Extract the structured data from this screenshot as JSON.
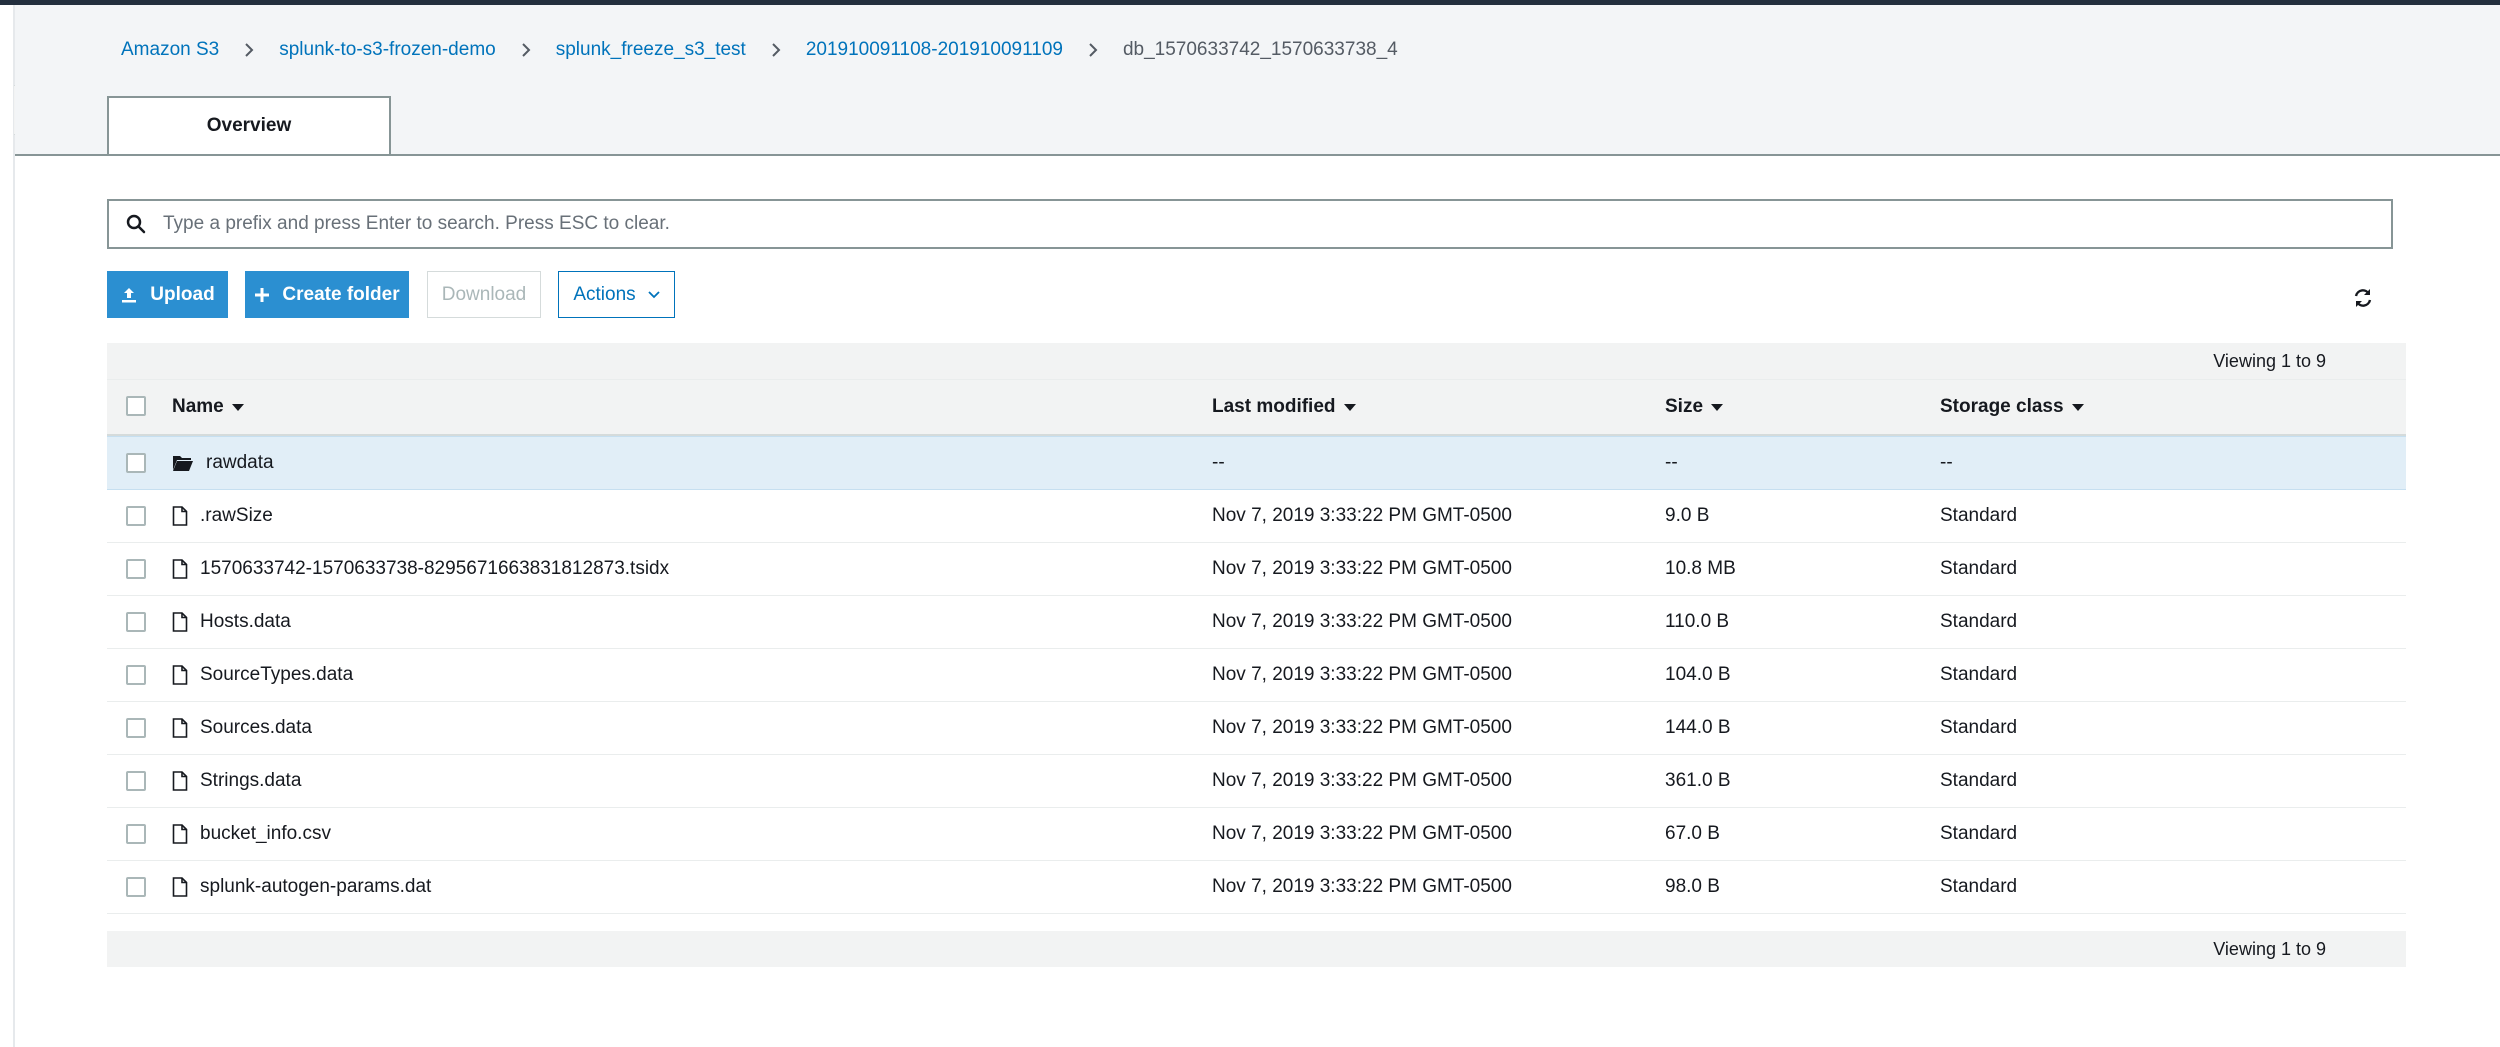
{
  "breadcrumb": [
    {
      "label": "Amazon S3",
      "link": true
    },
    {
      "label": "splunk-to-s3-frozen-demo",
      "link": true
    },
    {
      "label": "splunk_freeze_s3_test",
      "link": true
    },
    {
      "label": "201910091108-201910091109",
      "link": true
    },
    {
      "label": "db_1570633742_1570633738_4",
      "link": false
    }
  ],
  "tabs": {
    "overview": "Overview"
  },
  "search": {
    "placeholder": "Type a prefix and press Enter to search. Press ESC to clear."
  },
  "toolbar": {
    "upload": "Upload",
    "create_folder": "Create folder",
    "download": "Download",
    "actions": "Actions"
  },
  "table": {
    "viewing_top": "Viewing 1 to 9",
    "viewing_bottom": "Viewing 1 to 9",
    "columns": {
      "name": "Name",
      "last_modified": "Last modified",
      "size": "Size",
      "storage_class": "Storage class"
    },
    "rows": [
      {
        "type": "folder",
        "name": "rawdata",
        "modified": "--",
        "size": "--",
        "class": "--"
      },
      {
        "type": "file",
        "name": ".rawSize",
        "modified": "Nov 7, 2019 3:33:22 PM GMT-0500",
        "size": "9.0 B",
        "class": "Standard"
      },
      {
        "type": "file",
        "name": "1570633742-1570633738-8295671663831812873.tsidx",
        "modified": "Nov 7, 2019 3:33:22 PM GMT-0500",
        "size": "10.8 MB",
        "class": "Standard"
      },
      {
        "type": "file",
        "name": "Hosts.data",
        "modified": "Nov 7, 2019 3:33:22 PM GMT-0500",
        "size": "110.0 B",
        "class": "Standard"
      },
      {
        "type": "file",
        "name": "SourceTypes.data",
        "modified": "Nov 7, 2019 3:33:22 PM GMT-0500",
        "size": "104.0 B",
        "class": "Standard"
      },
      {
        "type": "file",
        "name": "Sources.data",
        "modified": "Nov 7, 2019 3:33:22 PM GMT-0500",
        "size": "144.0 B",
        "class": "Standard"
      },
      {
        "type": "file",
        "name": "Strings.data",
        "modified": "Nov 7, 2019 3:33:22 PM GMT-0500",
        "size": "361.0 B",
        "class": "Standard"
      },
      {
        "type": "file",
        "name": "bucket_info.csv",
        "modified": "Nov 7, 2019 3:33:22 PM GMT-0500",
        "size": "67.0 B",
        "class": "Standard"
      },
      {
        "type": "file",
        "name": "splunk-autogen-params.dat",
        "modified": "Nov 7, 2019 3:33:22 PM GMT-0500",
        "size": "98.0 B",
        "class": "Standard"
      }
    ]
  },
  "icons": {
    "search": "search-icon",
    "upload": "upload-icon",
    "create_folder": "plus-icon",
    "actions": "chevron-down-icon",
    "refresh": "refresh-icon",
    "folder": "folder-open-icon",
    "file": "file-icon",
    "breadcrumb_separator": "chevron-right-icon",
    "sidebar_toggle": "caret-right-icon"
  },
  "colors": {
    "link": "#0073bb",
    "primary_button": "#2b8fd1",
    "selected_row": "#e1eef7",
    "header_band": "#f3f5f7",
    "top_bar": "#232f3e"
  }
}
